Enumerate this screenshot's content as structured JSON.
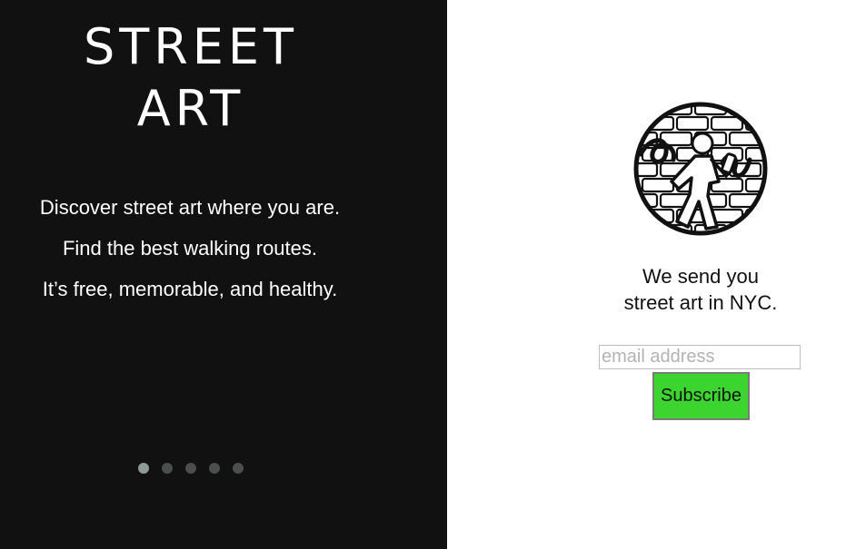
{
  "hero": {
    "title_line_1": "STREET",
    "title_line_2": "ART",
    "taglines": [
      "Discover street art where you are.",
      "Find the best walking routes.",
      "It’s free, memorable, and healthy."
    ]
  },
  "carousel": {
    "dot_count": 5,
    "active_index": 0
  },
  "signup": {
    "logo_icon": "street-art-walker-brick-wall-icon",
    "pitch_line_1": "We send you",
    "pitch_line_2": "street art in NYC.",
    "email_placeholder": "email address",
    "email_value": "",
    "subscribe_label": "Subscribe"
  },
  "colors": {
    "left_background": "#111111",
    "button_green": "#3cd42e",
    "dot_active": "#8e9a96",
    "dot_inactive": "#4a4f4d"
  }
}
